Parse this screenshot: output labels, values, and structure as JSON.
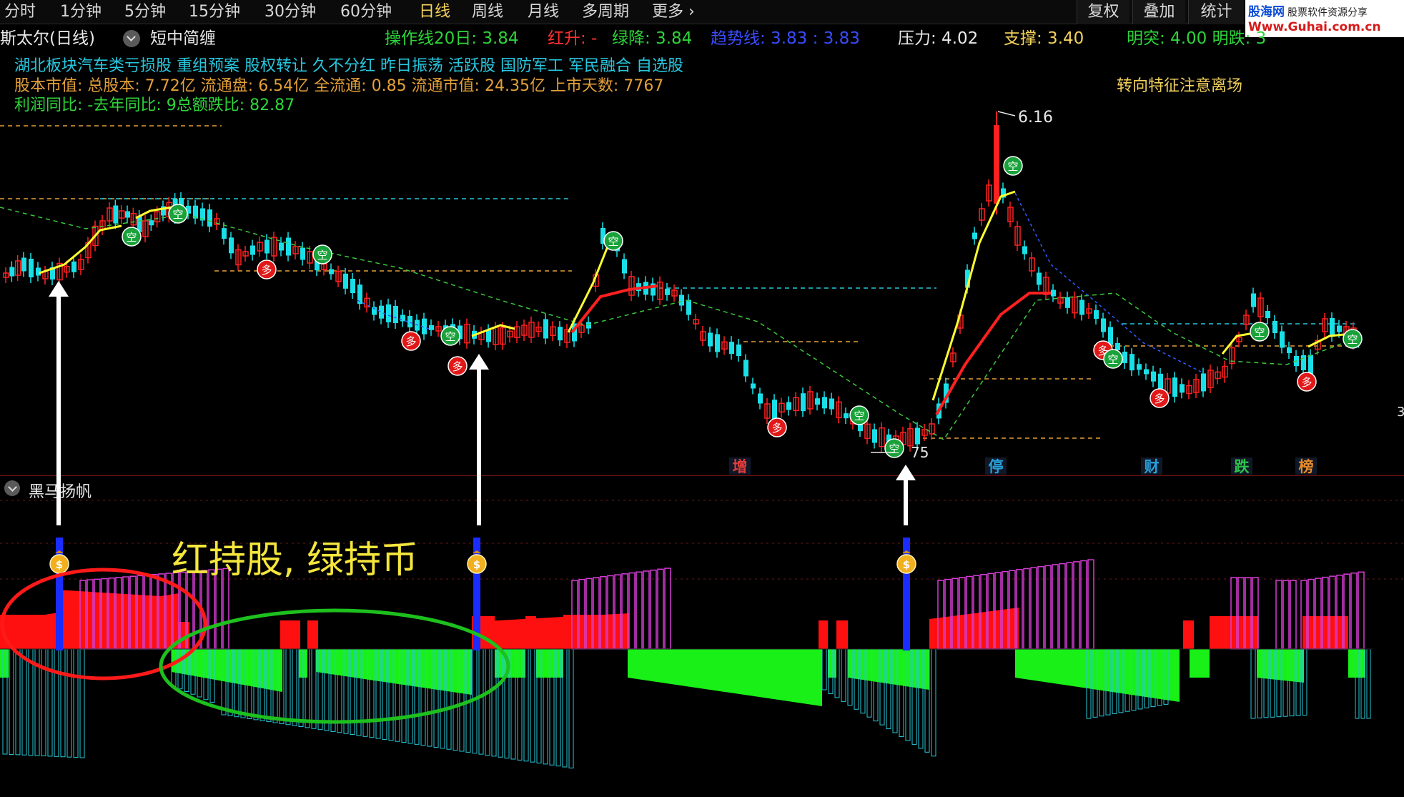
{
  "toolbar": {
    "periods": [
      "分时",
      "1分钟",
      "5分钟",
      "15分钟",
      "30分钟",
      "60分钟",
      "日线",
      "周线",
      "月线",
      "多周期",
      "更多 ›"
    ],
    "active_period": "日线",
    "right_buttons": [
      "复权",
      "叠加",
      "统计"
    ]
  },
  "watermark": {
    "brand": "股海网",
    "slogan": "股票软件资源分享",
    "url": "Www.Guhai.com.cn"
  },
  "infobar": {
    "stock_name": "斯太尔(日线)",
    "indicator_name": "短中简缠",
    "op_line": "操作线20日: 3.84",
    "red_up": "红升: -",
    "green_down": "绿降: 3.84",
    "trend_line": "趋势线: 3.83 : 3.83",
    "pressure": "压力: 4.02",
    "support": "支撑: 3.40",
    "partial_right": "明突: 4.00  明跌: 3"
  },
  "concepts": "湖北板块汽车类亏损股  重组预案  股权转让  久不分红  昨日振荡  活跃股  国防军工  军民融合  自选股",
  "capital": "股本市值: 总股本: 7.72亿  流通盘: 6.54亿  全流通: 0.85  流通市值: 24.35亿  上市天数: 7767",
  "profit": "利润同比: -去年同比: 9总额跌比: 82.87",
  "signal_text": "转向特征注意离场",
  "price_labels": {
    "high": "6.16",
    "low": "75",
    "right_edge": "3"
  },
  "markers": {
    "buy": "多",
    "sell": "空"
  },
  "event_tags": [
    {
      "text": "增",
      "color": "#e23b3b"
    },
    {
      "text": "停",
      "color": "#27a0d8"
    },
    {
      "text": "财",
      "color": "#27a0d8"
    },
    {
      "text": "跌",
      "color": "#2cc24a"
    },
    {
      "text": "榜",
      "color": "#e48a2a"
    }
  ],
  "indicator_panel": {
    "title": "黑马扬帆",
    "annotation": "红持股, 绿持币",
    "money_icon": "money-bag-icon"
  },
  "colors": {
    "up": "#ff2020",
    "down": "#19e0e8",
    "yellow_line": "#ffff30",
    "red_line": "#ff2020",
    "green_dash": "#3cc83c",
    "blue_dash": "#2f5cff",
    "pos_bar": "#ff1010",
    "neg_bar": "#18f018",
    "magenta": "#d63cd6",
    "cyan_outline": "#27c8d8",
    "signal_blue": "#1a2cff"
  }
}
